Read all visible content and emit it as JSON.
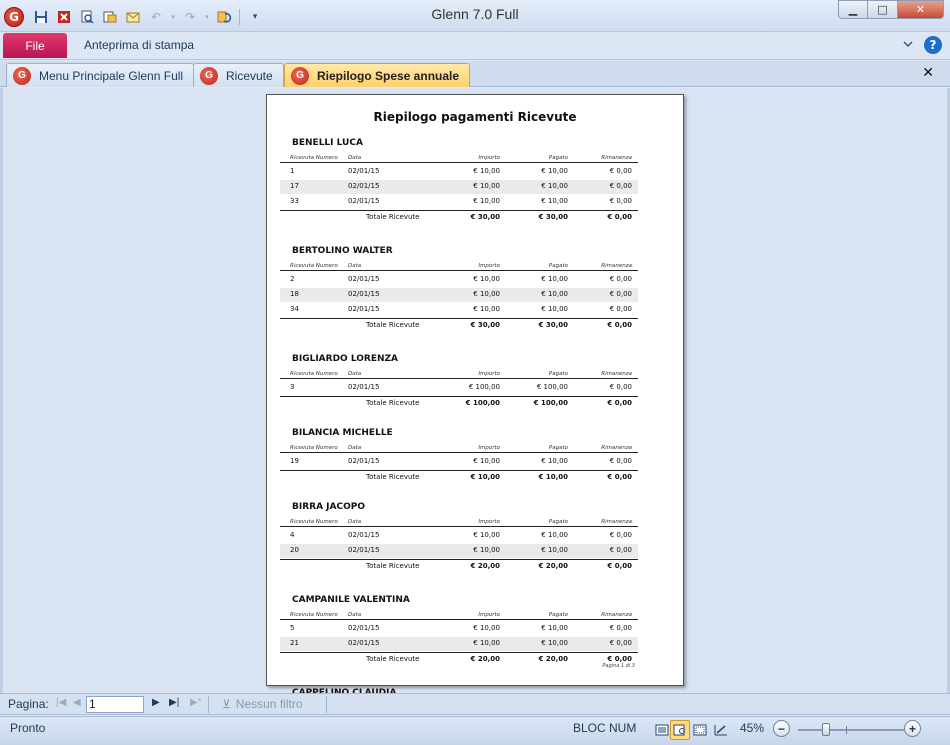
{
  "window": {
    "title": "Glenn 7.0 Full",
    "app_icon": "G",
    "controls": {
      "minimize": "▁",
      "maximize": "□",
      "close": "✕"
    }
  },
  "ribbon": {
    "file_label": "File",
    "tab_label": "Anteprima di stampa"
  },
  "doc_tabs": [
    {
      "label": "Menu Principale Glenn Full"
    },
    {
      "label": "Ricevute"
    },
    {
      "label": "Riepilogo Spese annuale"
    }
  ],
  "report": {
    "title": "Riepilogo pagamenti Ricevute",
    "columns": [
      "Ricevuta Numero",
      "Data",
      "Importo",
      "Pagato",
      "Rimanenza"
    ],
    "total_label": "Totale Ricevute",
    "page_label": "Pagina 1 di 3",
    "groups": [
      {
        "name": "BENELLI LUCA",
        "rows": [
          [
            "1",
            "02/01/15",
            "€ 10,00",
            "€ 10,00",
            "€ 0,00"
          ],
          [
            "17",
            "02/01/15",
            "€ 10,00",
            "€ 10,00",
            "€ 0,00"
          ],
          [
            "33",
            "02/01/15",
            "€ 10,00",
            "€ 10,00",
            "€ 0,00"
          ]
        ],
        "totals": [
          "€ 30,00",
          "€ 30,00",
          "€ 0,00"
        ]
      },
      {
        "name": "BERTOLINO WALTER",
        "rows": [
          [
            "2",
            "02/01/15",
            "€ 10,00",
            "€ 10,00",
            "€ 0,00"
          ],
          [
            "18",
            "02/01/15",
            "€ 10,00",
            "€ 10,00",
            "€ 0,00"
          ],
          [
            "34",
            "02/01/15",
            "€ 10,00",
            "€ 10,00",
            "€ 0,00"
          ]
        ],
        "totals": [
          "€ 30,00",
          "€ 30,00",
          "€ 0,00"
        ]
      },
      {
        "name": "BIGLIARDO LORENZA",
        "rows": [
          [
            "3",
            "02/01/15",
            "€ 100,00",
            "€ 100,00",
            "€ 0,00"
          ]
        ],
        "totals": [
          "€ 100,00",
          "€ 100,00",
          "€ 0,00"
        ]
      },
      {
        "name": "BILANCIA MICHELLE",
        "rows": [
          [
            "19",
            "02/01/15",
            "€ 10,00",
            "€ 10,00",
            "€ 0,00"
          ]
        ],
        "totals": [
          "€ 10,00",
          "€ 10,00",
          "€ 0,00"
        ]
      },
      {
        "name": "BIRRA JACOPO",
        "rows": [
          [
            "4",
            "02/01/15",
            "€ 10,00",
            "€ 10,00",
            "€ 0,00"
          ],
          [
            "20",
            "02/01/15",
            "€ 10,00",
            "€ 10,00",
            "€ 0,00"
          ]
        ],
        "totals": [
          "€ 20,00",
          "€ 20,00",
          "€ 0,00"
        ]
      },
      {
        "name": "CAMPANILE VALENTINA",
        "rows": [
          [
            "5",
            "02/01/15",
            "€ 10,00",
            "€ 10,00",
            "€ 0,00"
          ],
          [
            "21",
            "02/01/15",
            "€ 10,00",
            "€ 10,00",
            "€ 0,00"
          ]
        ],
        "totals": [
          "€ 20,00",
          "€ 20,00",
          "€ 0,00"
        ]
      },
      {
        "name": "CAPPELINO CLAUDIA",
        "rows": [],
        "totals": null
      }
    ]
  },
  "navbar": {
    "page_label": "Pagina:",
    "page_value": "1",
    "filter_label": "Nessun filtro"
  },
  "statusbar": {
    "status": "Pronto",
    "numlock": "BLOC NUM",
    "zoom": "45%",
    "zoom_level_percent": 45
  }
}
